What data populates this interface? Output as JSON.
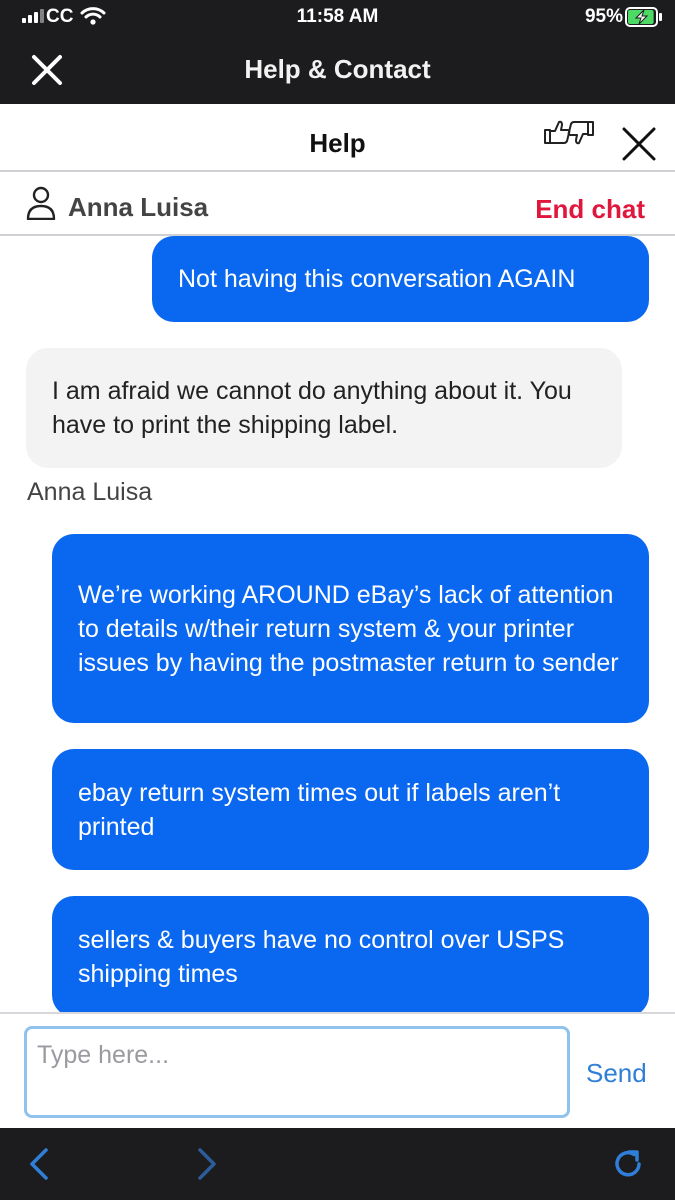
{
  "status_bar": {
    "carrier": "CC",
    "time": "11:58 AM",
    "battery_percent": "95%",
    "battery_level": 0.95,
    "battery_charging": true
  },
  "top_bar": {
    "title": "Help & Contact",
    "close_icon": "close-icon"
  },
  "help_header": {
    "title": "Help",
    "feedback_icon": "thumbs-up-down-icon",
    "close_icon": "close-icon"
  },
  "agent": {
    "name": "Anna Luisa",
    "icon": "person-icon",
    "end_chat_label": "End chat"
  },
  "messages": [
    {
      "from": "user",
      "text": "Not having this conversation AGAIN"
    },
    {
      "from": "agent",
      "text": "I am afraid we cannot do anything about it. You have to print the shipping label.",
      "sender": "Anna Luisa"
    },
    {
      "from": "user",
      "text": "We’re working AROUND eBay’s lack of attention to details w/their return system & your printer issues by having the postmaster return to sender"
    },
    {
      "from": "user",
      "text": "ebay return system times out if labels aren’t printed"
    },
    {
      "from": "user",
      "text": "sellers & buyers have no control over USPS shipping times"
    }
  ],
  "composer": {
    "placeholder": "Type here...",
    "value": "",
    "send_label": "Send"
  },
  "bottom_nav": {
    "back_icon": "chevron-left-icon",
    "forward_icon": "chevron-right-icon",
    "reload_icon": "reload-icon"
  },
  "colors": {
    "user_bubble": "#0a68f0",
    "agent_bubble": "#f3f3f4",
    "end_chat": "#e0163d",
    "send": "#2f7fd8",
    "bars": "#1c1c1e"
  }
}
